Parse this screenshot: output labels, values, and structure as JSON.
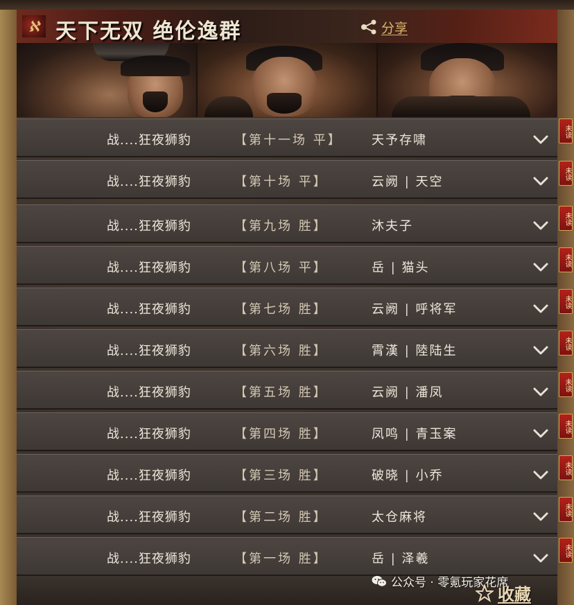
{
  "header": {
    "title": "天下无双 绝伦逸群",
    "share_label": "分享"
  },
  "colors": {
    "accent_gold": "#d9b56b",
    "unread_red": "#b3221a",
    "row_bg": "#4d4541"
  },
  "icons": {
    "logo": "faction-logo-icon",
    "share": "share-icon",
    "expand": "chevron-down-icon",
    "favorite": "star-icon",
    "wechat": "wechat-icon"
  },
  "matches": [
    {
      "player": "战....狂夜狮豹",
      "match": "【第十一场 平】",
      "opponent": "天予存啸",
      "unread": "未读"
    },
    {
      "player": "战....狂夜狮豹",
      "match": "【第十场 平】",
      "opponent": "云阙 | 天空",
      "unread": "未读"
    },
    {
      "player": "战....狂夜狮豹",
      "match": "【第九场 胜】",
      "opponent": "沐夫子",
      "unread": "未读"
    },
    {
      "player": "战....狂夜狮豹",
      "match": "【第八场 平】",
      "opponent": "岳 | 猫头",
      "unread": "未读"
    },
    {
      "player": "战....狂夜狮豹",
      "match": "【第七场 胜】",
      "opponent": "云阙 | 呼将军",
      "unread": "未读"
    },
    {
      "player": "战....狂夜狮豹",
      "match": "【第六场 胜】",
      "opponent": "霄漢 | 陸陆生",
      "unread": "未读"
    },
    {
      "player": "战....狂夜狮豹",
      "match": "【第五场 胜】",
      "opponent": "云阙 | 潘凤",
      "unread": "未读"
    },
    {
      "player": "战....狂夜狮豹",
      "match": "【第四场 胜】",
      "opponent": "凤鸣 | 青玉案",
      "unread": "未读"
    },
    {
      "player": "战....狂夜狮豹",
      "match": "【第三场 胜】",
      "opponent": "破晓 | 小乔",
      "unread": "未读"
    },
    {
      "player": "战....狂夜狮豹",
      "match": "【第二场 胜】",
      "opponent": "太仓麻将",
      "unread": "未读"
    },
    {
      "player": "战....狂夜狮豹",
      "match": "【第一场 胜】",
      "opponent": "岳 | 泽羲",
      "unread": "未读"
    }
  ],
  "footer": {
    "watermark": "公众号 · 零氪玩家花席",
    "favorite_label": "收藏"
  }
}
